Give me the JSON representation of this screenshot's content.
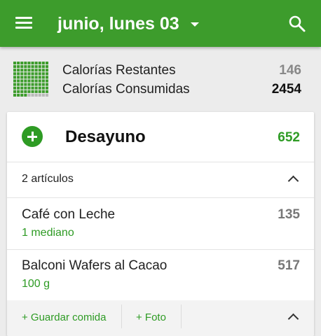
{
  "header": {
    "title": "junio, lunes 03"
  },
  "summary": {
    "remaining_label": "Calorías Restantes",
    "remaining_value": "146",
    "consumed_label": "Calorías Consumidas",
    "consumed_value": "2454"
  },
  "meal": {
    "title": "Desayuno",
    "total": "652",
    "items_count_label": "2 artículos",
    "items": [
      {
        "name": "Café con Leche",
        "portion": "1 mediano",
        "calories": "135"
      },
      {
        "name": "Balconi Wafers al Cacao",
        "portion": "100 g",
        "calories": "517"
      }
    ],
    "save_meal_label": "+ Guardar comida",
    "photo_label": "+ Foto"
  },
  "colors": {
    "brand_green": "#3d9c2c",
    "accent_green": "#2e9b24"
  }
}
